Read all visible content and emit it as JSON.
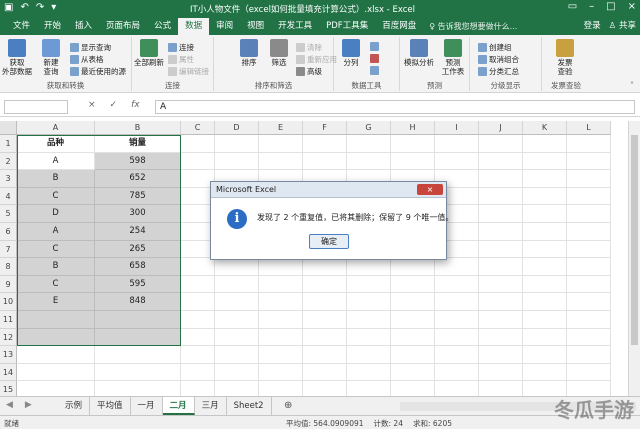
{
  "titlebar": {
    "title": "IT小人物文件（excel如何批量填充计算公式）.xlsx - Excel",
    "qa_icons": [
      "save-icon",
      "undo-icon",
      "redo-icon",
      "customize-icon"
    ],
    "win_icons": [
      "ribbon-display-icon",
      "minimize-icon",
      "maximize-icon",
      "close-icon"
    ]
  },
  "tabs": [
    {
      "label": "文件"
    },
    {
      "label": "开始"
    },
    {
      "label": "插入"
    },
    {
      "label": "页面布局"
    },
    {
      "label": "公式"
    },
    {
      "label": "数据",
      "active": true
    },
    {
      "label": "审阅"
    },
    {
      "label": "视图"
    },
    {
      "label": "开发工具"
    },
    {
      "label": "PDF工具集"
    },
    {
      "label": "百度网盘"
    }
  ],
  "search": {
    "text": "告诉我您想要做什么..."
  },
  "account": {
    "login": "登录",
    "share": "共享"
  },
  "ribbon": {
    "groups": [
      {
        "id": "get",
        "label": "获取和转换",
        "big": [
          {
            "label": "获取\n外部数据",
            "icon": "external-data-icon"
          },
          {
            "label": "新建\n查询",
            "icon": "new-query-icon"
          }
        ],
        "small": [
          {
            "label": "显示查询"
          },
          {
            "label": "从表格"
          },
          {
            "label": "最近使用的源"
          }
        ]
      },
      {
        "id": "conn",
        "label": "连接",
        "big": [
          {
            "label": "全部刷新",
            "icon": "refresh-all-icon"
          }
        ],
        "small": [
          {
            "label": "连接"
          },
          {
            "label": "属性",
            "disabled": true
          },
          {
            "label": "编辑链接",
            "disabled": true
          }
        ]
      },
      {
        "id": "sort",
        "label": "排序和筛选",
        "big": [
          {
            "label": "排序",
            "icon": "sort-icon"
          },
          {
            "label": "筛选",
            "icon": "filter-icon"
          }
        ],
        "small": [
          {
            "label": "清除",
            "disabled": true
          },
          {
            "label": "重新应用",
            "disabled": true
          },
          {
            "label": "高级"
          }
        ]
      },
      {
        "id": "tools",
        "label": "数据工具",
        "big": [
          {
            "label": "分列",
            "icon": "text-to-columns-icon"
          }
        ]
      },
      {
        "id": "forecast",
        "label": "预测",
        "big": [
          {
            "label": "模拟分析",
            "icon": "what-if-icon"
          },
          {
            "label": "预测\n工作表",
            "icon": "forecast-sheet-icon"
          }
        ]
      },
      {
        "id": "outline",
        "label": "分级显示",
        "small": [
          {
            "label": "创建组"
          },
          {
            "label": "取消组合"
          },
          {
            "label": "分类汇总"
          }
        ]
      },
      {
        "id": "invoice",
        "label": "发票查验",
        "big": [
          {
            "label": "发票\n查验",
            "icon": "invoice-check-icon"
          }
        ]
      }
    ]
  },
  "formula_bar": {
    "cell_ref": "",
    "cancel": "×",
    "enter": "✓",
    "fx": "fx",
    "value": "A"
  },
  "grid": {
    "columns": [
      "A",
      "B",
      "C",
      "D",
      "E",
      "F",
      "G",
      "H",
      "I",
      "J",
      "K",
      "L"
    ],
    "rows": [
      "1",
      "2",
      "3",
      "4",
      "5",
      "6",
      "7",
      "8",
      "9",
      "10",
      "11",
      "12",
      "13",
      "14",
      "15"
    ],
    "header": [
      "品种",
      "销量"
    ],
    "data": [
      [
        "A",
        "598"
      ],
      [
        "B",
        "652"
      ],
      [
        "C",
        "785"
      ],
      [
        "D",
        "300"
      ],
      [
        "A",
        "254"
      ],
      [
        "C",
        "265"
      ],
      [
        "B",
        "658"
      ],
      [
        "C",
        "595"
      ],
      [
        "E",
        "848"
      ]
    ]
  },
  "sheets": [
    {
      "label": "示例"
    },
    {
      "label": "平均值"
    },
    {
      "label": "一月"
    },
    {
      "label": "二月",
      "active": true
    },
    {
      "label": "三月"
    },
    {
      "label": "Sheet2"
    }
  ],
  "add_sheet": "⊕",
  "status": {
    "mode": "就绪",
    "average": "平均值: 564.0909091",
    "count": "计数: 24",
    "sum": "求和: 6205"
  },
  "dialog": {
    "title": "Microsoft Excel",
    "message": "发现了 2 个重复值，已将其删除；保留了 9 个唯一值。",
    "ok": "确定",
    "close": "×",
    "icon": "info-icon"
  },
  "watermark": "冬瓜手游"
}
